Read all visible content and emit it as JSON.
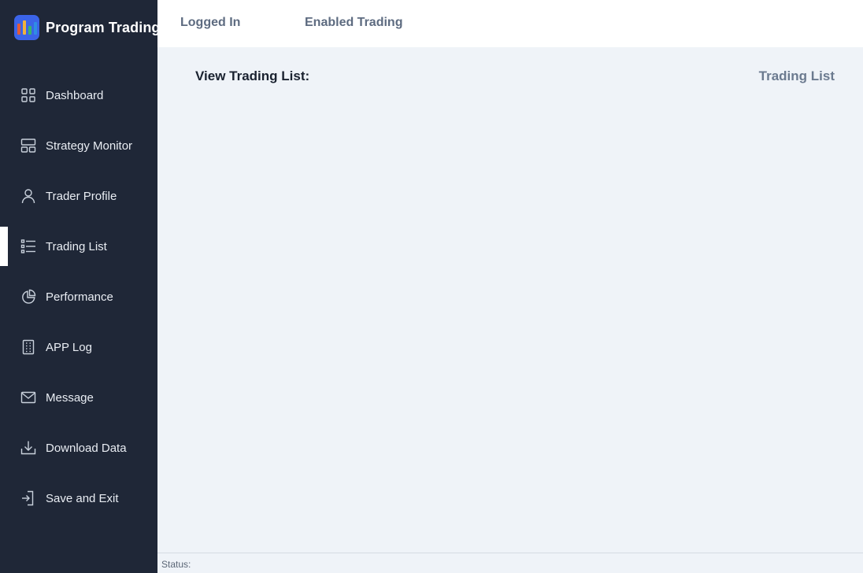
{
  "app": {
    "title": "Program Trading",
    "logo_bar_colors": [
      "#e05a3a",
      "#f0b23c",
      "#39b66a",
      "#2f8de4"
    ]
  },
  "topbar": {
    "logged_in": "Logged In",
    "enabled_trading": "Enabled Trading"
  },
  "sidebar": {
    "active_item": "Trading List",
    "items": [
      {
        "label": "Dashboard",
        "icon": "grid-icon"
      },
      {
        "label": "Strategy Monitor",
        "icon": "layout-icon"
      },
      {
        "label": "Trader Profile",
        "icon": "user-icon"
      },
      {
        "label": "Trading List",
        "icon": "list-icon"
      },
      {
        "label": "Performance",
        "icon": "pie-chart-icon"
      },
      {
        "label": "APP Log",
        "icon": "log-icon"
      },
      {
        "label": "Message",
        "icon": "mail-icon"
      },
      {
        "label": "Download Data",
        "icon": "download-icon"
      },
      {
        "label": "Save and Exit",
        "icon": "exit-icon"
      }
    ]
  },
  "main": {
    "view_title": "View Trading List:",
    "section_name": "Trading List"
  },
  "status": {
    "label": "Status:"
  },
  "colors": {
    "sidebar_bg": "#1f2737",
    "main_bg": "#eff3f8",
    "accent": "#3b64e8"
  }
}
